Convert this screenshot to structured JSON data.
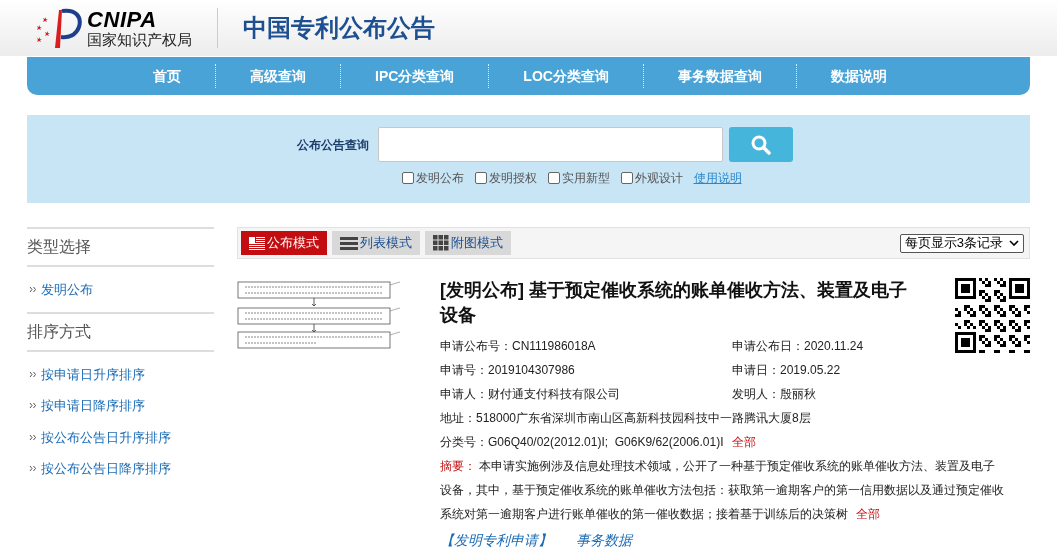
{
  "header": {
    "logo_en": "CNIPA",
    "logo_cn": "国家知识产权局",
    "site_title": "中国专利公布公告"
  },
  "nav": [
    "首页",
    "高级查询",
    "IPC分类查询",
    "LOC分类查询",
    "事务数据查询",
    "数据说明"
  ],
  "search": {
    "label": "公布公告查询",
    "options": [
      {
        "label": "发明公布",
        "checked": false
      },
      {
        "label": "发明授权",
        "checked": false
      },
      {
        "label": "实用新型",
        "checked": false
      },
      {
        "label": "外观设计",
        "checked": false
      }
    ],
    "help_link": "使用说明"
  },
  "sidebar": [
    {
      "heading": "类型选择",
      "items": [
        "发明公布"
      ]
    },
    {
      "heading": "排序方式",
      "items": [
        "按申请日升序排序",
        "按申请日降序排序",
        "按公布公告日升序排序",
        "按公布公告日降序排序"
      ]
    }
  ],
  "view_modes": [
    {
      "kind": "publication",
      "label": "公布模式",
      "selected": true
    },
    {
      "kind": "list",
      "label": "列表模式",
      "selected": false
    },
    {
      "kind": "grid",
      "label": "附图模式",
      "selected": false
    }
  ],
  "page_size": "每页显示3条记录",
  "record": {
    "title": "[发明公布] 基于预定催收系统的账单催收方法、装置及电子设备",
    "fields": [
      {
        "label": "申请公布号：",
        "value": "CN111986018A"
      },
      {
        "label": "申请公布日：",
        "value": "2020.11.24"
      },
      {
        "label": "申请号：",
        "value": "2019104307986"
      },
      {
        "label": "申请日：",
        "value": "2019.05.22"
      },
      {
        "label": "申请人：",
        "value": "财付通支付科技有限公司"
      },
      {
        "label": "发明人：",
        "value": "殷丽秋"
      }
    ],
    "address": {
      "label": "地址：",
      "value": "518000广东省深圳市南山区高新科技园科技中一路腾讯大厦8层"
    },
    "classification": {
      "label": "分类号：",
      "value": "G06Q40/02(2012.01)I;  G06K9/62(2006.01)I",
      "more": "全部"
    },
    "abstract": {
      "label": "摘要：",
      "text": "本申请实施例涉及信息处理技术领域，公开了一种基于预定催收系统的账单催收方法、装置及电子设备，其中，基于预定催收系统的账单催收方法包括：获取第一逾期客户的第一信用数据以及通过预定催收系统对第一逾期客户进行账单催收的第一催收数据；接着基于训练后的决策树",
      "more": "全部"
    },
    "links": [
      "【发明专利申请】",
      "事务数据"
    ]
  }
}
